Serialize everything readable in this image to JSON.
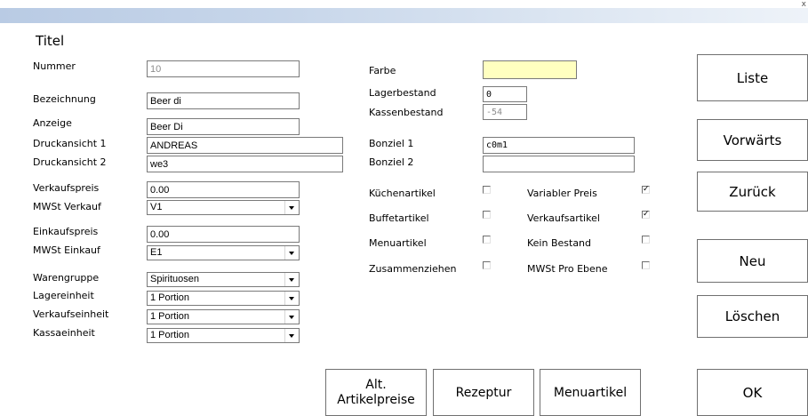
{
  "window": {
    "close_glyph": "x",
    "title": "Titel"
  },
  "left": {
    "nummer": {
      "label": "Nummer",
      "value": "10"
    },
    "bezeichnung": {
      "label": "Bezeichnung",
      "value": "Beer di"
    },
    "anzeige": {
      "label": "Anzeige",
      "value": "Beer Di"
    },
    "druckansicht1": {
      "label": "Druckansicht 1",
      "value": "ANDREAS"
    },
    "druckansicht2": {
      "label": "Druckansicht 2",
      "value": "we3"
    },
    "verkaufspreis": {
      "label": "Verkaufspreis",
      "value": "0.00"
    },
    "mwst_verkauf": {
      "label": "MWSt Verkauf",
      "value": "V1"
    },
    "einkaufspreis": {
      "label": "Einkaufspreis",
      "value": "0.00"
    },
    "mwst_einkauf": {
      "label": "MWSt Einkauf",
      "value": "E1"
    },
    "warengruppe": {
      "label": "Warengruppe",
      "value": "Spirituosen"
    },
    "lagereinheit": {
      "label": "Lagereinheit",
      "value": "1 Portion"
    },
    "verkaufseinheit": {
      "label": "Verkaufseinheit",
      "value": "1 Portion"
    },
    "kassaeinheit": {
      "label": "Kassaeinheit",
      "value": "1 Portion"
    }
  },
  "middle": {
    "farbe": {
      "label": "Farbe",
      "value": "",
      "color": "#ffffc0"
    },
    "lagerbestand": {
      "label": "Lagerbestand",
      "value": "0"
    },
    "kassenbestand": {
      "label": "Kassenbestand",
      "value": "-54"
    },
    "bonziel1": {
      "label": "Bonziel 1",
      "value": "c0m1"
    },
    "bonziel2": {
      "label": "Bonziel 2",
      "value": ""
    }
  },
  "checks": {
    "kuechenartikel": {
      "label": "Küchenartikel",
      "checked": false
    },
    "buffetartikel": {
      "label": "Buffetartikel",
      "checked": false
    },
    "menuartikel": {
      "label": "Menuartikel",
      "checked": false
    },
    "zusammenziehen": {
      "label": "Zusammenziehen",
      "checked": false
    },
    "variabler_preis": {
      "label": "Variabler Preis",
      "checked": true
    },
    "verkaufsartikel": {
      "label": "Verkaufsartikel",
      "checked": true
    },
    "kein_bestand": {
      "label": "Kein Bestand",
      "checked": false
    },
    "mwst_pro_ebene": {
      "label": "MWSt Pro Ebene",
      "checked": false
    },
    "check_mark": "✓"
  },
  "right_buttons": {
    "liste": "Liste",
    "vorwaerts": "Vorwärts",
    "zurueck": "Zurück",
    "neu": "Neu",
    "loeschen": "Löschen",
    "ok": "OK"
  },
  "bottom_buttons": {
    "alt_artikelpreise_line1": "Alt.",
    "alt_artikelpreise_line2": "Artikelpreise",
    "rezeptur": "Rezeptur",
    "menuartikel": "Menuartikel"
  }
}
